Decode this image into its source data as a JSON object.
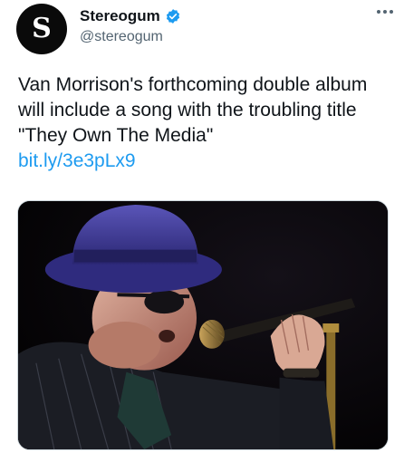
{
  "account": {
    "avatar_letter": "S",
    "display_name": "Stereogum",
    "handle": "@stereogum",
    "verified": true
  },
  "tweet": {
    "text": "Van Morrison's forthcoming double album will include a song with the troubling title \"They Own The Media\"",
    "link": "bit.ly/3e3pLx9"
  },
  "icons": {
    "verified": "verified-badge-icon",
    "more": "more-options-icon"
  },
  "colors": {
    "link": "#1d9bf0",
    "verified": "#1d9bf0",
    "handle": "#536471"
  }
}
